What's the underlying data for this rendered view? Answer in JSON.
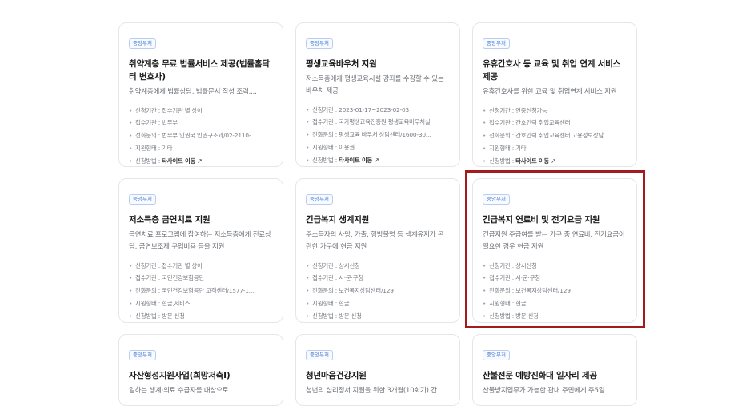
{
  "cards": [
    {
      "badge": "중앙부처",
      "title": "취약계층 무료 법률서비스 제공(법률홈닥터 변호사)",
      "desc": "취약계층에게 법률상담, 법률문서 작성 조력,...",
      "items": [
        "신청기간 : 접수기관 별 상이",
        "접수기관 : 법무부",
        "전화문의 : 법무부 인권국 인권구조과/02-2110-...",
        "지원형태 : 기타"
      ],
      "method_prefix": "신청방법 : ",
      "method": "타사이트 이동",
      "method_link": true
    },
    {
      "badge": "중앙부처",
      "title": "평생교육바우처 지원",
      "desc": "저소득층에게 평생교육시설 강좌를 수강할 수 있는 바우처 제공",
      "items": [
        "신청기간 : 2023-01-17~2023-02-03",
        "접수기관 : 국가평생교육진흥원 평생교육바우처실",
        "전화문의 : 평생교육 바우처 상담센터/1600-30...",
        "지원형태 : 이용권"
      ],
      "method_prefix": "신청방법 : ",
      "method": "타사이트 이동",
      "method_link": true
    },
    {
      "badge": "중앙부처",
      "title": "유휴간호사 등 교육 및 취업 연계 서비스 제공",
      "desc": "유휴간호사를 위한 교육 및 취업연계 서비스 지원",
      "items": [
        "신청기간 : 연중신청가능",
        "접수기관 : 간호인력 취업교육센터",
        "전화문의 : 간호인력 취업교육센터 고용정보상담...",
        "지원형태 : 기타"
      ],
      "method_prefix": "신청방법 : ",
      "method": "타사이트 이동",
      "method_link": true
    },
    {
      "badge": "중앙부처",
      "title": "저소득층 금연치료 지원",
      "desc": "금연치료 프로그램에 참여하는 저소득층에게 진료상담, 금연보조제 구입비용 등을 지원",
      "items": [
        "신청기간 : 접수기관 별 상이",
        "접수기관 : 국민건강보험공단",
        "전화문의 : 국민건강보험공단 고객센터/1577-1...",
        "지원형태 : 현금,서비스"
      ],
      "method_prefix": "신청방법 : ",
      "method": "방문 신청",
      "method_link": false
    },
    {
      "badge": "중앙부처",
      "title": "긴급복지 생계지원",
      "desc": "주소득자의 사망, 가출, 행방불명 등 생계유지가 곤란한 가구에 현금 지원",
      "items": [
        "신청기간 : 상시신청",
        "접수기관 : 시·군·구청",
        "전화문의 : 보건복지상담센터/129",
        "지원형태 : 현금"
      ],
      "method_prefix": "신청방법 : ",
      "method": "방문 신청",
      "method_link": false
    },
    {
      "badge": "중앙부처",
      "title": "긴급복지 연료비 및 전기요금 지원",
      "desc": "긴급지원 주급여를 받는 가구 중 연료비, 전기요금이 필요한 경우 현금 지원",
      "items": [
        "신청기간 : 상시신청",
        "접수기관 : 시·군·구청",
        "전화문의 : 보건복지상담센터/129",
        "지원형태 : 현금"
      ],
      "method_prefix": "신청방법 : ",
      "method": "방문 신청",
      "method_link": false
    },
    {
      "badge": "중앙부처",
      "title": "자산형성지원사업(희망저축I)",
      "desc": "일하는 생계·의료 수급자를 대상으로",
      "items": [],
      "method_prefix": "",
      "method": "",
      "method_link": false
    },
    {
      "badge": "중앙부처",
      "title": "청년마음건강지원",
      "desc": "청년의 심리정서 지원을 위한 3개월(10회기) 간",
      "items": [],
      "method_prefix": "",
      "method": "",
      "method_link": false
    },
    {
      "badge": "중앙부처",
      "title": "산불전문 예방진화대 일자리 제공",
      "desc": "산불방지업무가 가능한 관내 주민에게 주5일",
      "items": [],
      "method_prefix": "",
      "method": "",
      "method_link": false
    }
  ],
  "icons": {
    "external_link": "external-link-icon"
  },
  "colors": {
    "highlight_border": "#a31b1f",
    "badge_text": "#4a7bd4"
  }
}
